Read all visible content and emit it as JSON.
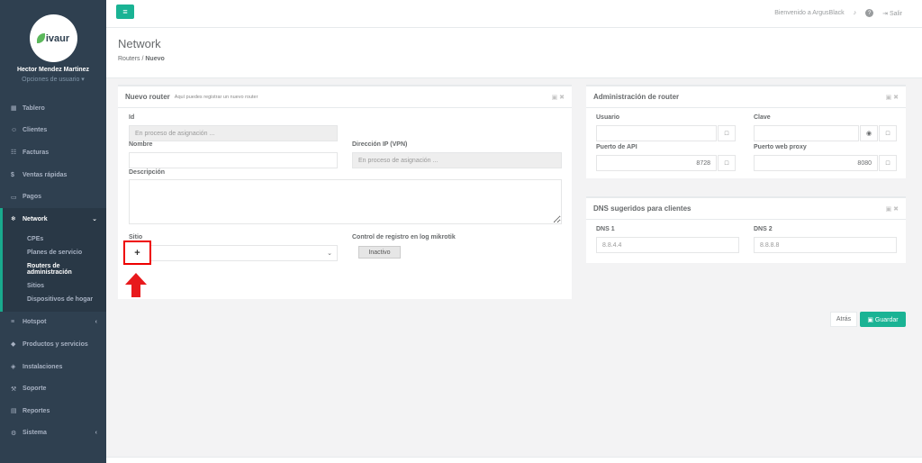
{
  "profile": {
    "logo_text": "ivaur",
    "name": "Hector Mendez Martinez",
    "options": "Opciones de usuario ▾"
  },
  "nav": {
    "items": [
      {
        "label": "Tablero",
        "icon": "▦"
      },
      {
        "label": "Clientes",
        "icon": "☺"
      },
      {
        "label": "Facturas",
        "icon": "☷"
      },
      {
        "label": "Ventas rápidas",
        "icon": "$"
      },
      {
        "label": "Pagos",
        "icon": "▭"
      },
      {
        "label": "Network",
        "icon": "❄",
        "chev": "⌄"
      },
      {
        "label": "Hotspot",
        "icon": "≡",
        "chev": "‹"
      },
      {
        "label": "Productos y servicios",
        "icon": "◆"
      },
      {
        "label": "Instalaciones",
        "icon": "◈"
      },
      {
        "label": "Soporte",
        "icon": "⚒"
      },
      {
        "label": "Reportes",
        "icon": "▤"
      },
      {
        "label": "Sistema",
        "icon": "⚙",
        "chev": "‹"
      }
    ],
    "sub": [
      "CPEs",
      "Planes de servicio",
      "Routers de administración",
      "Sitios",
      "Dispositivos de hogar"
    ]
  },
  "topbar": {
    "menu_icon": "≡",
    "welcome": "Bienvenido a ArgusBlack",
    "bell": "♪",
    "help": "?",
    "logout": "⇥ Salir"
  },
  "page": {
    "title": "Network",
    "crumb_parent": "Routers",
    "crumb_sep": "/",
    "crumb_current": "Nuevo"
  },
  "panel_main": {
    "title": "Nuevo router",
    "subtitle": "Aquí puedes registrar un nuevo router",
    "tools": "▣ ✖",
    "id_label": "Id",
    "id_placeholder": "En proceso de asignación ...",
    "name_label": "Nombre",
    "ip_label": "Dirección IP (VPN)",
    "ip_placeholder": "En proceso de asignación ...",
    "desc_label": "Descripción",
    "site_label": "Sitio",
    "site_add": "+",
    "site_chevron": "⌄",
    "log_label": "Control de registro en log mikrotik",
    "log_toggle": "Inactivo"
  },
  "panel_admin": {
    "title": "Administración de router",
    "tools": "▣ ✖",
    "user_label": "Usuario",
    "pass_label": "Clave",
    "api_label": "Puerto de API",
    "api_value": "8728",
    "proxy_label": "Puerto web proxy",
    "proxy_value": "8080",
    "lock_icon": "□",
    "eye_icon": "◉"
  },
  "panel_dns": {
    "title": "DNS sugeridos para clientes",
    "tools": "▣ ✖",
    "dns1_label": "DNS 1",
    "dns1_value": "8.8.4.4",
    "dns2_label": "DNS 2",
    "dns2_value": "8.8.8.8"
  },
  "actions": {
    "back": "Atrás",
    "save": "▣ Guardar"
  }
}
